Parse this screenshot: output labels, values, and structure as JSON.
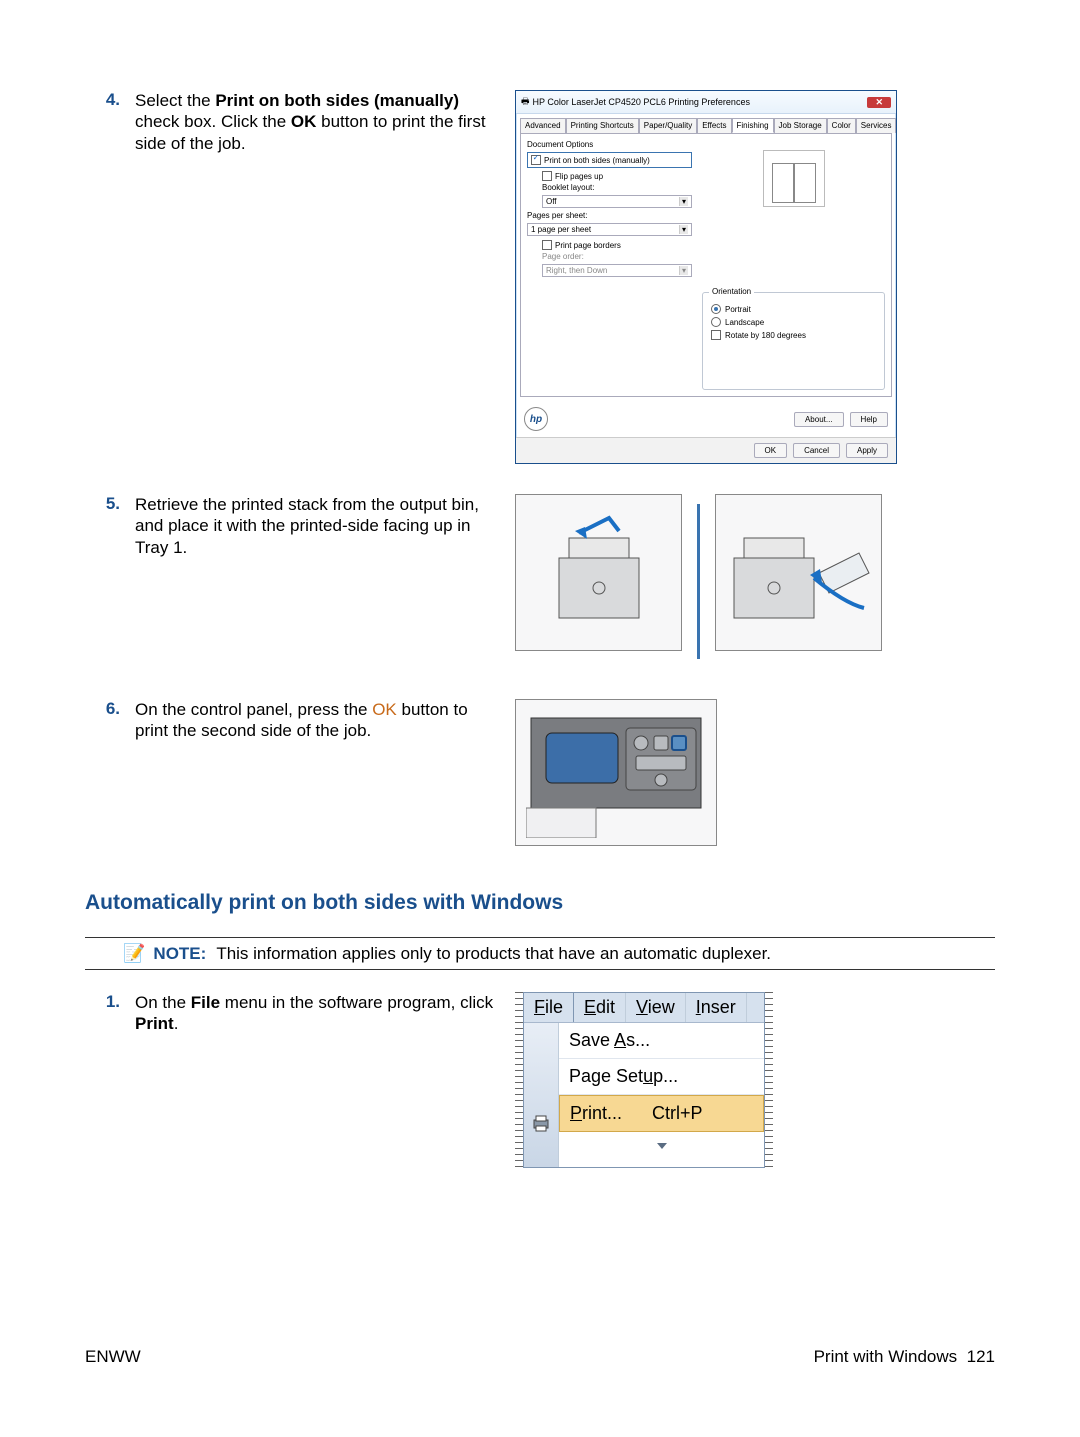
{
  "steps": {
    "s4": {
      "num": "4.",
      "body_prefix": "Select the ",
      "bold1": "Print on both sides (manually)",
      "body_mid": " check box. Click the ",
      "bold2": "OK",
      "body_suffix": " button to print the first side of the job."
    },
    "s5": {
      "num": "5.",
      "body": "Retrieve the printed stack from the output bin, and place it with the printed-side facing up in Tray 1."
    },
    "s6": {
      "num": "6.",
      "body_prefix": "On the control panel, press the ",
      "btn": "OK",
      "body_suffix": " button to print the second side of the job."
    },
    "auto1": {
      "num": "1.",
      "body_prefix": "On the ",
      "bold1": "File",
      "body_mid": " menu in the software program, click ",
      "bold2": "Print",
      "body_suffix": "."
    }
  },
  "section_title": "Automatically print on both sides with Windows",
  "note": {
    "label": "NOTE:",
    "text": "This information applies only to products that have an automatic duplexer."
  },
  "dialog": {
    "title": "HP Color LaserJet CP4520 PCL6 Printing Preferences",
    "tabs": [
      "Advanced",
      "Printing Shortcuts",
      "Paper/Quality",
      "Effects",
      "Finishing",
      "Job Storage",
      "Color",
      "Services"
    ],
    "doc_options_title": "Document Options",
    "print_both": "Print on both sides (manually)",
    "flip_pages": "Flip pages up",
    "booklet": "Booklet layout:",
    "booklet_val": "Off",
    "pps": "Pages per sheet:",
    "pps_val": "1 page per sheet",
    "borders": "Print page borders",
    "page_order": "Page order:",
    "page_order_val": "Right, then Down",
    "orientation": "Orientation",
    "portrait": "Portrait",
    "landscape": "Landscape",
    "rotate": "Rotate by 180 degrees",
    "about": "About...",
    "help": "Help",
    "ok": "OK",
    "cancel": "Cancel",
    "apply": "Apply"
  },
  "filemenu": {
    "file": "File",
    "edit": "Edit",
    "view": "View",
    "insert": "Inser",
    "saveas": "Save As...",
    "pagesetup": "Page Setup...",
    "print": "Print...",
    "print_sc": "Ctrl+P"
  },
  "footer": {
    "left": "ENWW",
    "right_label": "Print with Windows",
    "page": "121"
  }
}
